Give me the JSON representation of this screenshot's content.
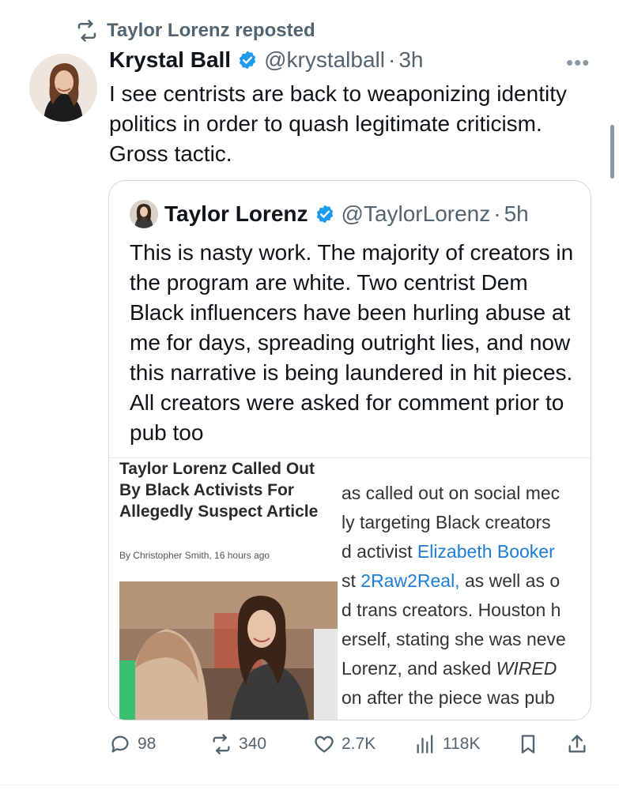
{
  "repost": {
    "text": "Taylor Lorenz reposted"
  },
  "tweet": {
    "name": "Krystal Ball",
    "handle": "@krystalball",
    "dot": "·",
    "time": "3h",
    "text": "I see centrists are back to weaponizing identity politics in order to quash legitimate criticism. Gross tactic."
  },
  "quote": {
    "name": "Taylor Lorenz",
    "handle": "@TaylorLorenz",
    "dot": "·",
    "time": "5h",
    "text": "This is nasty work. The majority of creators in the program are white. Two centrist Dem Black influencers have been hurling abuse at me for days, spreading outright lies, and now this narrative is being laundered in hit pieces. All creators were asked for comment prior to pub too",
    "article": {
      "title": "Taylor Lorenz Called Out By Black Activists For Allegedly Suspect Article",
      "byline": "By Christopher Smith, 16 hours ago",
      "lines": [
        {
          "pre": "as called out on social mec",
          "link": "",
          "post": ""
        },
        {
          "pre": "ly targeting Black creators",
          "link": "",
          "post": ""
        },
        {
          "pre": "d activist ",
          "link": "Elizabeth Booker",
          "post": ""
        },
        {
          "pre": "st ",
          "link": "2Raw2Real,",
          "post": " as well as o"
        },
        {
          "pre": "d trans creators. Houston h",
          "link": "",
          "post": ""
        },
        {
          "pre": "erself, stating she was neve",
          "link": "",
          "post": ""
        },
        {
          "pre": " Lorenz, and asked ",
          "link": "",
          "post": "",
          "em": "WIRED"
        },
        {
          "pre": "on after the piece was pub",
          "link": "",
          "post": ""
        }
      ]
    }
  },
  "actions": {
    "replies": "98",
    "reposts": "340",
    "likes": "2.7K",
    "views": "118K"
  },
  "colors": {
    "accent": "#1d9bf0",
    "muted": "#536471",
    "link": "#1d7dd6"
  }
}
